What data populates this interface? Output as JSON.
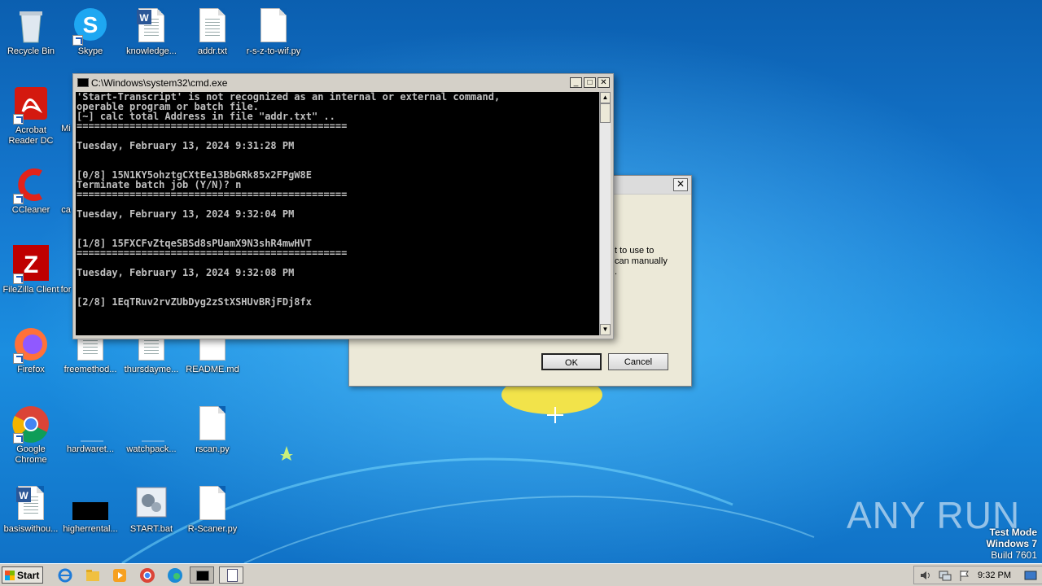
{
  "desktop": {
    "icons": [
      {
        "label": "Recycle Bin"
      },
      {
        "label": "Skype"
      },
      {
        "label": "knowledge..."
      },
      {
        "label": "addr.txt"
      },
      {
        "label": "r-s-z-to-wif.py"
      },
      {
        "label": "Acrobat Reader DC"
      },
      {
        "label": "Mi"
      },
      {
        "label": "CCleaner"
      },
      {
        "label": "ca"
      },
      {
        "label": "FileZilla Client"
      },
      {
        "label": "for"
      },
      {
        "label": "Firefox"
      },
      {
        "label": "freemethod..."
      },
      {
        "label": "thursdayme..."
      },
      {
        "label": "README.md"
      },
      {
        "label": "Google Chrome"
      },
      {
        "label": "hardwaret..."
      },
      {
        "label": "watchpack..."
      },
      {
        "label": "rscan.py"
      },
      {
        "label": "basiswithou..."
      },
      {
        "label": "higherrental..."
      },
      {
        "label": "START.bat"
      },
      {
        "label": "R-Scaner.py"
      }
    ]
  },
  "dialog": {
    "text_line1": "t to use to",
    "text_line2": "can manually",
    "text_line3": ".",
    "ok_label": "OK",
    "cancel_label": "Cancel",
    "close_glyph": "✕"
  },
  "cmd": {
    "title": "C:\\Windows\\system32\\cmd.exe",
    "lines": [
      "'Start-Transcript' is not recognized as an internal or external command,",
      "operable program or batch file.",
      "[~] calc total Address in file \"addr.txt\" ..",
      "==============================================",
      "",
      "Tuesday, February 13, 2024 9:31:28 PM",
      "",
      "",
      "[0/8] 15N1KY5ohztgCXtEe13BbGRk85x2FPgW8E",
      "Terminate batch job (Y/N)? n",
      "==============================================",
      "",
      "Tuesday, February 13, 2024 9:32:04 PM",
      "",
      "",
      "[1/8] 15FXCFvZtqeSBSd8sPUamX9N3shR4mwHVT",
      "==============================================",
      "",
      "Tuesday, February 13, 2024 9:32:08 PM",
      "",
      "",
      "[2/8] 1EqTRuv2rvZUbDyg2zStXSHUvBRjFDj8fx",
      "",
      "",
      ""
    ]
  },
  "taskbar": {
    "start_label": "Start",
    "clock": "9:32 PM"
  },
  "watermark": {
    "brand": "ANY RUN",
    "test_mode": "Test Mode",
    "os": "Windows 7",
    "build": "Build 7601"
  }
}
